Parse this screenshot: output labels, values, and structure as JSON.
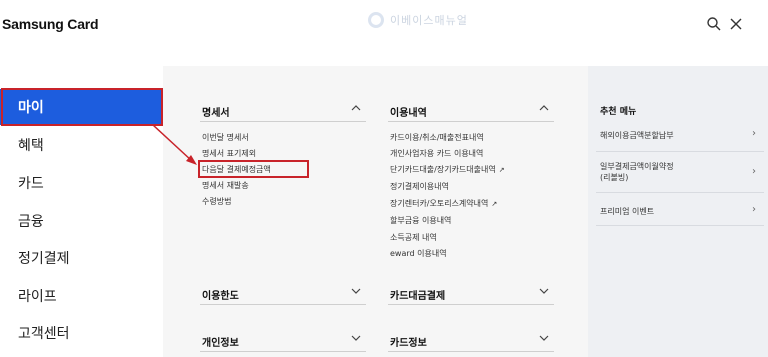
{
  "header": {
    "logo": "Samsung Card",
    "watermark": "이베이스매뉴얼",
    "search_icon": "search-icon",
    "close_icon": "close-icon"
  },
  "left_nav": {
    "items": [
      "마이",
      "혜택",
      "카드",
      "금융",
      "정기결제",
      "라이프",
      "고객센터"
    ],
    "active_index": 0
  },
  "sections": {
    "statement": {
      "title": "명세서",
      "links": [
        "이번달 명세서",
        "명세서 표기제외",
        "다음달 결제예정금액",
        "명세서 재발송",
        "수령방법"
      ]
    },
    "usage": {
      "title": "이용내역",
      "links": [
        "카드이용/취소/매출전표내역",
        "개인사업자용 카드 이용내역",
        "단기카드대출/장기카드대출내역",
        "정기결제이용내역",
        "장기렌터카/오토리스계약내역",
        "할부금융 이용내역",
        "소득공제 내역",
        "eward 이용내역"
      ]
    },
    "limit": {
      "title": "이용한도"
    },
    "loan_payment": {
      "title": "카드대금결제"
    },
    "personal": {
      "title": "개인정보"
    },
    "card_info": {
      "title": "카드정보"
    }
  },
  "recommended": {
    "title": "추천 메뉴",
    "items": [
      {
        "label": "해외이용금액분할납부"
      },
      {
        "label_lines": [
          "일부결제금액이월약정",
          "(리볼빙)"
        ]
      },
      {
        "label": "프리미엄 이벤트"
      }
    ]
  },
  "colors": {
    "active_nav": "#1d5dde",
    "highlight": "#c8232a",
    "mid_background": "#f6f6f6",
    "right_background": "#eef0f3"
  }
}
